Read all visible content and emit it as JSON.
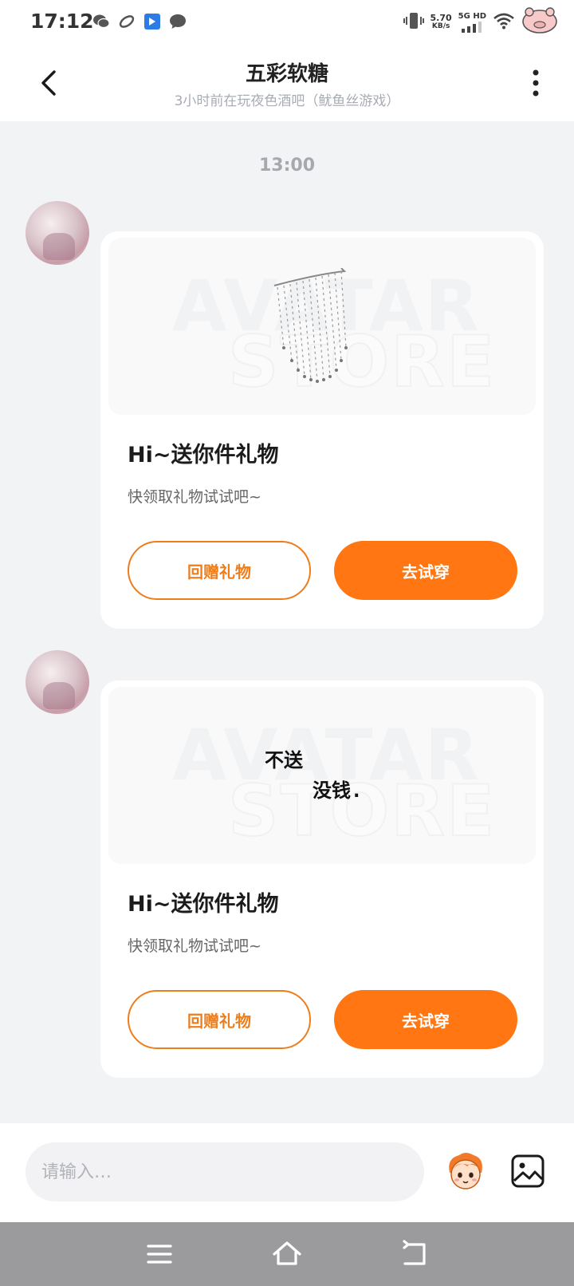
{
  "status_bar": {
    "time": "17:12",
    "net_speed_value": "5.70",
    "net_speed_unit": "KB/s",
    "network_type": "5G HD"
  },
  "header": {
    "title": "五彩软糖",
    "subtitle": "3小时前在玩夜色酒吧（鱿鱼丝游戏）"
  },
  "chat": {
    "time_divider": "13:00",
    "messages": [
      {
        "watermark_line1": "AVATAR",
        "watermark_line2": "STORE",
        "title": "Hi~送你件礼物",
        "desc": "快领取礼物试试吧~",
        "return_gift_label": "回赠礼物",
        "try_on_label": "去试穿"
      },
      {
        "watermark_line1": "AVATAR",
        "watermark_line2": "STORE",
        "image_text_1": "不送",
        "image_text_2": "没钱.",
        "title": "Hi~送你件礼物",
        "desc": "快领取礼物试试吧~",
        "return_gift_label": "回赠礼物",
        "try_on_label": "去试穿"
      }
    ]
  },
  "input": {
    "placeholder": "请输入…"
  },
  "colors": {
    "accent": "#ff7612",
    "accent_border": "#ee7d1c",
    "background": "#f2f3f5"
  }
}
